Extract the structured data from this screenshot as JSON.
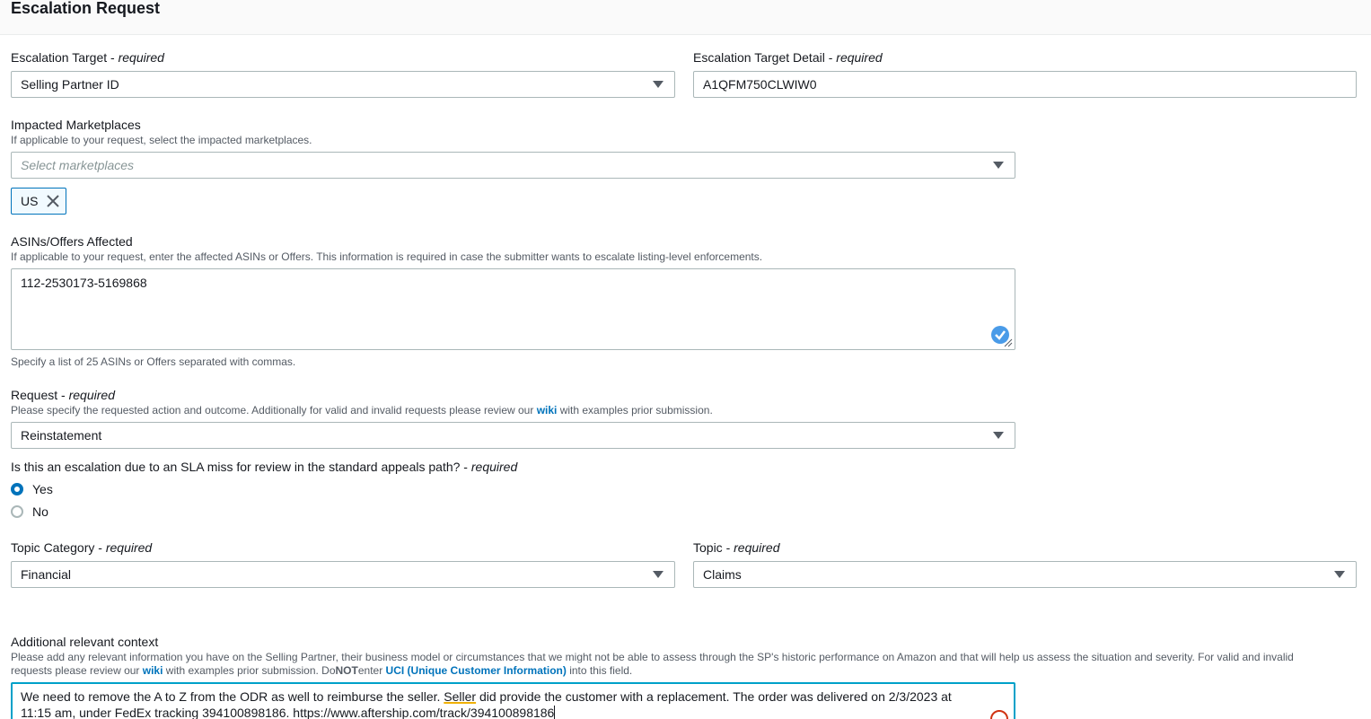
{
  "header": {
    "title": "Escalation Request"
  },
  "required_suffix": "required",
  "escalation_target": {
    "label": "Escalation Target",
    "value": "Selling Partner ID"
  },
  "escalation_target_detail": {
    "label": "Escalation Target Detail",
    "value": "A1QFM750CLWIW0"
  },
  "impacted_marketplaces": {
    "label": "Impacted Marketplaces",
    "hint": "If applicable to your request, select the impacted marketplaces.",
    "placeholder": "Select marketplaces",
    "tokens": [
      "US"
    ]
  },
  "asins": {
    "label": "ASINs/Offers Affected",
    "hint": "If applicable to your request, enter the affected ASINs or Offers. This information is required in case the submitter wants to escalate listing-level enforcements.",
    "value": "112-2530173-5169868",
    "help": "Specify a list of 25 ASINs or Offers separated with commas."
  },
  "request": {
    "label": "Request",
    "hint_before": "Please specify the requested action and outcome. Additionally for valid and invalid requests please review our ",
    "hint_link": "wiki",
    "hint_after": " with examples prior submission.",
    "value": "Reinstatement"
  },
  "sla_question": {
    "label": "Is this an escalation due to an SLA miss for review in the standard appeals path?",
    "options": [
      {
        "label": "Yes",
        "checked": true
      },
      {
        "label": "No",
        "checked": false
      }
    ]
  },
  "topic_category": {
    "label": "Topic Category",
    "value": "Financial"
  },
  "topic": {
    "label": "Topic",
    "value": "Claims"
  },
  "context": {
    "label": "Additional relevant context",
    "hint_line1": "Please add any relevant information you have on the Selling Partner, their business model or circumstances that we might not be able to assess through the SP's historic performance on Amazon and that will help us assess the situation and severity. For valid and invalid",
    "hint_line2_a": "requests please review our ",
    "hint_link": "wiki",
    "hint_line2_b": " with examples prior submission. Do",
    "hint_not": "NOT",
    "hint_line2_c": "enter ",
    "hint_uci": "UCI (Unique Customer Information)",
    "hint_line2_d": " into this field.",
    "text_a": "We need to remove the A to Z from the ODR as well to reimburse the seller. ",
    "text_warn": "Seller",
    "text_b": " did provide the customer with a replacement. The order was delivered on 2/3/2023 at",
    "text_line2": "11:15 am, under FedEx tracking 394100898186. https://www.aftership.com/track/394100898186"
  }
}
